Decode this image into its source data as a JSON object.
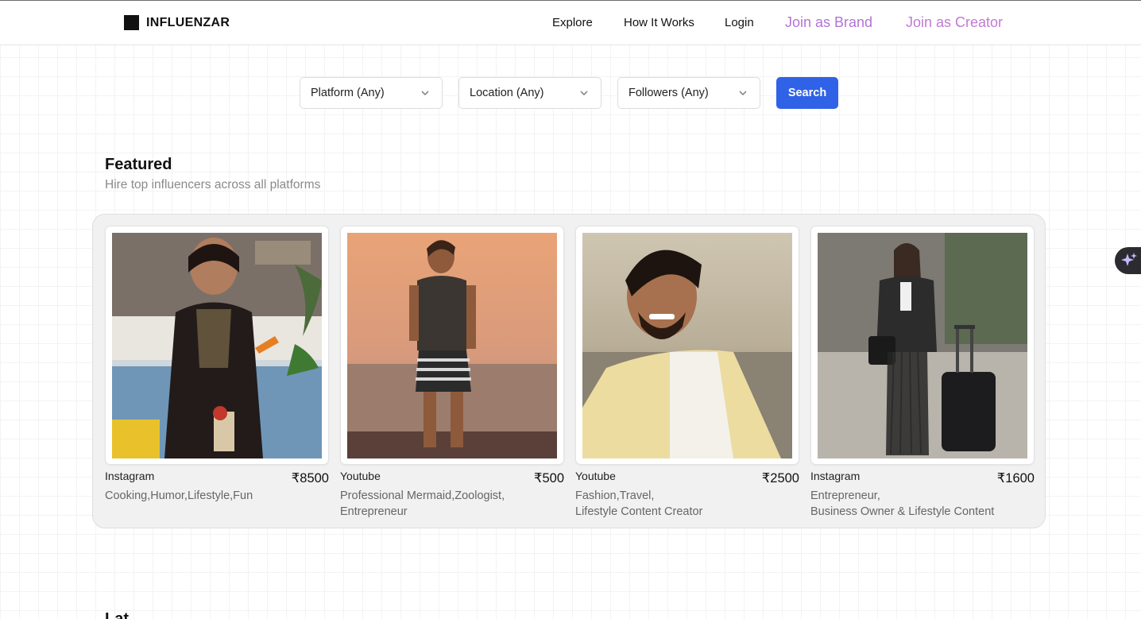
{
  "brand": {
    "name": "INFLUENZAR"
  },
  "nav": {
    "explore": "Explore",
    "how_it_works": "How It Works",
    "login": "Login",
    "join_brand": "Join as Brand",
    "join_creator": "Join as Creator",
    "accent_brand_color": "#b174d9",
    "accent_creator_color": "#c07ad4"
  },
  "filters": {
    "platform": "Platform (Any)",
    "location": "Location (Any)",
    "followers": "Followers (Any)",
    "search": "Search",
    "search_color": "#2f62e6"
  },
  "featured": {
    "title": "Featured",
    "subtitle": "Hire top influencers across all platforms"
  },
  "cards": [
    {
      "platform": "Instagram",
      "price": "₹8500",
      "tags": "Cooking,Humor,Lifestyle,Fun",
      "photo_icon": "creator-photo"
    },
    {
      "platform": "Youtube",
      "price": "₹500",
      "tags": "Professional Mermaid,Zoologist,\nEntrepreneur",
      "photo_icon": "creator-photo"
    },
    {
      "platform": "Youtube",
      "price": "₹2500",
      "tags": "Fashion,Travel,\nLifestyle Content Creator",
      "photo_icon": "creator-photo"
    },
    {
      "platform": "Instagram",
      "price": "₹1600",
      "tags": "Entrepreneur,\nBusiness Owner & Lifestyle Content",
      "photo_icon": "creator-photo"
    }
  ],
  "assistant": {
    "icon": "sparkle-icon"
  },
  "next_section": {
    "title_partial": "Lat"
  }
}
